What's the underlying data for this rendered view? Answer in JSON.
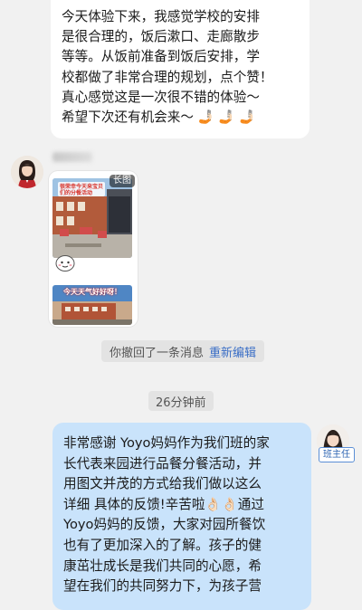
{
  "messages": {
    "first": {
      "lines": [
        "今天体验下来，我感觉学校的安排",
        "是很合理的，饭后漱口、走廊散步",
        "等等。从饭前准备到饭后安排，学",
        "校都做了非常合理的规划，点个赞！",
        "真心感觉这是一次很不错的体验～",
        "希望下次还有机会来～ 🤳🏻 🤳🏻 🤳🏻"
      ]
    },
    "image": {
      "badge": "长图",
      "headline": "很荣幸今天来宝贝们的分餐活动",
      "caption": "今天天气好好呀！"
    },
    "recall": {
      "text": "你撤回了一条消息",
      "action": "重新编辑"
    },
    "timestamp": "26分钟前",
    "teacher": {
      "role": "班主任",
      "lines": [
        "非常感谢 Yoyo妈妈作为我们班的家",
        "长代表来园进行品餐分餐活动，并",
        "用图文并茂的方式给我们做以这么",
        "详细 具体的反馈!辛苦啦👌🏻👌🏻通过",
        "Yoyo妈妈的反馈，大家对园所餐饮",
        "也有了更加深入的了解。孩子的健",
        "康茁壮成长是我们共同的心愿，希",
        "望在我们的共同努力下，为孩子营"
      ]
    }
  },
  "colors": {
    "background": "#f1f1f1",
    "incoming_bubble": "#ffffff",
    "outgoing_bubble": "#c9e3fb",
    "link": "#3a6ec6",
    "badge_border": "#5b8fd6"
  },
  "icons": {
    "parent_avatar": "avatar-woman-red-shirt",
    "teacher_avatar": "avatar-woman-long-hair",
    "sticker": "cartoon-sticker-icon"
  }
}
